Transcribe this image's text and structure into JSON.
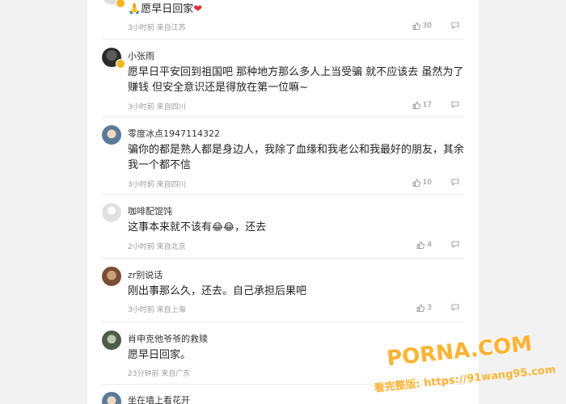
{
  "comments": [
    {
      "name": "",
      "text_prefix": "🙏",
      "text": "愿早日回家",
      "text_suffix": "❤",
      "meta": "3小时前 来自江苏",
      "likes": "30"
    },
    {
      "name": "小张雨",
      "text": "愿早日平安回到祖国吧 那种地方那么多人上当受骗 就不应该去 虽然为了赚钱 但安全意识还是得放在第一位嘛~",
      "meta": "3小时前 来自四川",
      "likes": "17"
    },
    {
      "name": "零度冰点1947114322",
      "text": "骗你的都是熟人都是身边人，我除了血缘和我老公和我最好的朋友，其余我一个都不信",
      "meta": "3小时前 来自四川",
      "likes": "10"
    },
    {
      "name": "咖啡配馄饨",
      "text": "这事本来就不该有",
      "text_emoji": "😂😂",
      "text_after": "，还去",
      "meta": "2小时前 来自北京",
      "likes": "4"
    },
    {
      "name": "zr别说话",
      "text": "刚出事那么久，还去。自己承担后果吧",
      "meta": "3小时前 来自上海",
      "likes": "3"
    },
    {
      "name": "肖申克他爷爷的救赎",
      "text": "愿早日回家。",
      "meta": "23分钟前 来自广东",
      "likes": ""
    },
    {
      "name": "坐在墙上看花开",
      "text": "",
      "meta": "",
      "likes": ""
    }
  ],
  "watermark": {
    "line1": "PORNA.COM",
    "line2": "看完整版: https://91wang95.com"
  },
  "colors": {
    "background": "#f2f2f2",
    "panel": "#ffffff",
    "watermark": "#ffb22e"
  }
}
